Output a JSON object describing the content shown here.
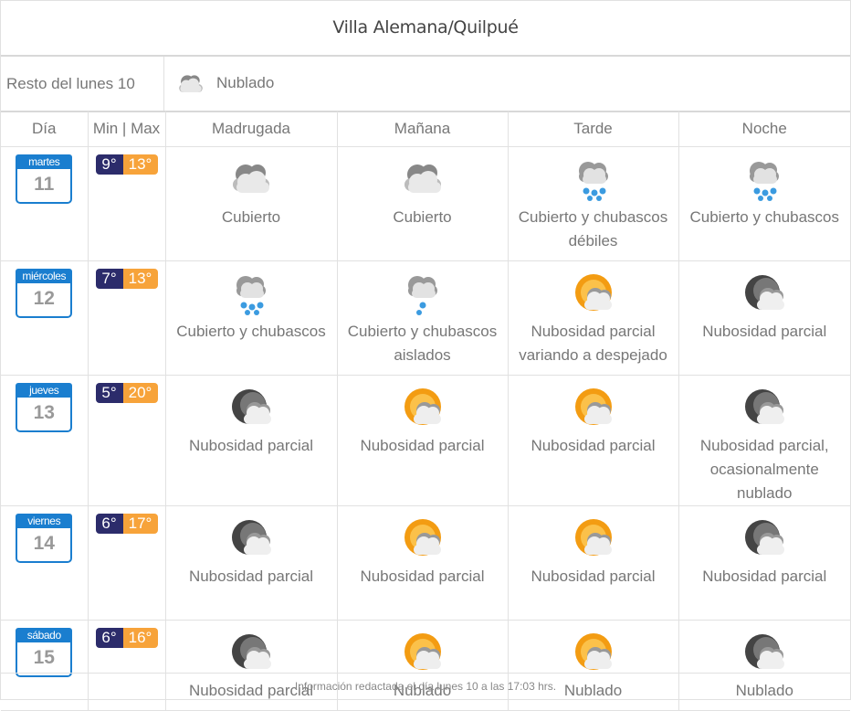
{
  "title": "Villa Alemana/Quilpué",
  "rest": {
    "label": "Resto del lunes 10",
    "icon": "cloud-icon",
    "condition": "Nublado"
  },
  "headers": {
    "day": "Día",
    "minmax": "Min | Max",
    "p1": "Madrugada",
    "p2": "Mañana",
    "p3": "Tarde",
    "p4": "Noche"
  },
  "days": [
    {
      "weekday": "martes",
      "date": "11",
      "min": "9°",
      "max": "13°",
      "periods": [
        {
          "icon": "cloud-icon",
          "cond": "Cubierto"
        },
        {
          "icon": "cloud-icon",
          "cond": "Cubierto"
        },
        {
          "icon": "rain-icon",
          "cond": "Cubierto y chubascos débiles"
        },
        {
          "icon": "rain-icon",
          "cond": "Cubierto y chubascos"
        }
      ]
    },
    {
      "weekday": "miércoles",
      "date": "12",
      "min": "7°",
      "max": "13°",
      "periods": [
        {
          "icon": "rain-icon",
          "cond": "Cubierto y chubascos"
        },
        {
          "icon": "drizzle-icon",
          "cond": "Cubierto y chubascos aislados"
        },
        {
          "icon": "sun-cloud-icon",
          "cond": "Nubosidad parcial variando a despejado"
        },
        {
          "icon": "moon-cloud-icon",
          "cond": "Nubosidad parcial"
        }
      ]
    },
    {
      "weekday": "jueves",
      "date": "13",
      "min": "5°",
      "max": "20°",
      "periods": [
        {
          "icon": "moon-cloud-icon",
          "cond": "Nubosidad parcial"
        },
        {
          "icon": "sun-cloud-icon",
          "cond": "Nubosidad parcial"
        },
        {
          "icon": "sun-cloud-icon",
          "cond": "Nubosidad parcial"
        },
        {
          "icon": "moon-cloud-icon",
          "cond": "Nubosidad parcial, ocasionalmente nublado"
        }
      ]
    },
    {
      "weekday": "viernes",
      "date": "14",
      "min": "6°",
      "max": "17°",
      "periods": [
        {
          "icon": "moon-cloud-icon",
          "cond": "Nubosidad parcial"
        },
        {
          "icon": "sun-cloud-icon",
          "cond": "Nubosidad parcial"
        },
        {
          "icon": "sun-cloud-icon",
          "cond": "Nubosidad parcial"
        },
        {
          "icon": "moon-cloud-icon",
          "cond": "Nubosidad parcial"
        }
      ]
    },
    {
      "weekday": "sábado",
      "date": "15",
      "min": "6°",
      "max": "16°",
      "periods": [
        {
          "icon": "moon-cloud-icon",
          "cond": "Nubosidad parcial"
        },
        {
          "icon": "sun-cloud-icon",
          "cond": "Nublado"
        },
        {
          "icon": "sun-cloud-icon",
          "cond": "Nublado"
        },
        {
          "icon": "moon-cloud-icon",
          "cond": "Nublado"
        }
      ]
    }
  ],
  "footer": "Información redactada el día lunes 10 a las 17:03 hrs."
}
